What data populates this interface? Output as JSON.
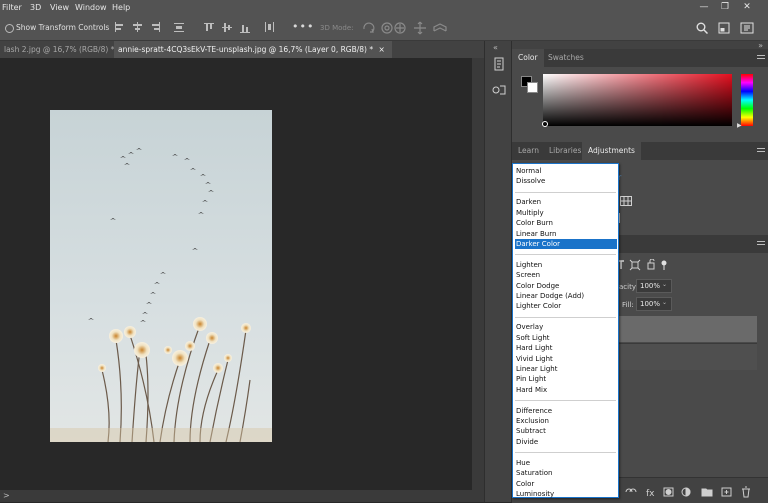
{
  "menu": [
    "Filter",
    "3D",
    "View",
    "Window",
    "Help"
  ],
  "options_bar": {
    "show_transform_controls": "Show Transform Controls",
    "mode_3d": "3D Mode:"
  },
  "tabs": [
    {
      "label": "lash 2.jpg @ 16,7% (RGB/8) *",
      "close": "×",
      "active": false
    },
    {
      "label": "annie-spratt-4CQ3sEkV-TE-unsplash.jpg @ 16,7% (Layer 0, RGB/8) *",
      "close": "×",
      "active": true
    }
  ],
  "color_panel": {
    "tabs": [
      "Color",
      "Swatches"
    ],
    "foreground": "#000000",
    "background": "#ffffff"
  },
  "adjust_panel": {
    "tabs": [
      "Learn",
      "Libraries",
      "Adjustments"
    ]
  },
  "layers_panel": {
    "opacity_label": "acity:",
    "opacity_value": "100%",
    "fill_label": "Fill:",
    "fill_value": "100%"
  },
  "blend_modes": {
    "groups": [
      [
        "Normal",
        "Dissolve"
      ],
      [
        "Darken",
        "Multiply",
        "Color Burn",
        "Linear Burn",
        "Darker Color"
      ],
      [
        "Lighten",
        "Screen",
        "Color Dodge",
        "Linear Dodge (Add)",
        "Lighter Color"
      ],
      [
        "Overlay",
        "Soft Light",
        "Hard Light",
        "Vivid Light",
        "Linear Light",
        "Pin Light",
        "Hard Mix"
      ],
      [
        "Difference",
        "Exclusion",
        "Subtract",
        "Divide"
      ],
      [
        "Hue",
        "Saturation",
        "Color",
        "Luminosity"
      ]
    ],
    "selected": "Darker Color"
  },
  "colors": {
    "accent": "#1a73c9",
    "panel": "#424242",
    "menubar": "#535353",
    "canvas": "#282828"
  },
  "bottom_status": ">"
}
